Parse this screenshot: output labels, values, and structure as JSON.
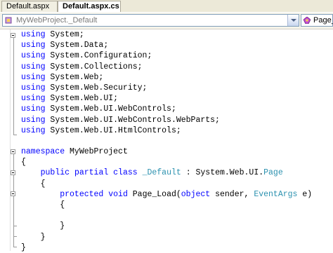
{
  "tabs": [
    {
      "label": "Default.aspx",
      "active": false
    },
    {
      "label": "Default.aspx.cs",
      "active": true
    }
  ],
  "navbar": {
    "class_combo": "MyWebProject._Default",
    "member_combo": "Page_"
  },
  "colors": {
    "keyword": "#0000ff",
    "type": "#2b91af",
    "text": "#000000"
  },
  "code": [
    [
      {
        "t": "using",
        "k": "kw"
      },
      {
        "t": " System;"
      }
    ],
    [
      {
        "t": "using",
        "k": "kw"
      },
      {
        "t": " System.Data;"
      }
    ],
    [
      {
        "t": "using",
        "k": "kw"
      },
      {
        "t": " System.Configuration;"
      }
    ],
    [
      {
        "t": "using",
        "k": "kw"
      },
      {
        "t": " System.Collections;"
      }
    ],
    [
      {
        "t": "using",
        "k": "kw"
      },
      {
        "t": " System.Web;"
      }
    ],
    [
      {
        "t": "using",
        "k": "kw"
      },
      {
        "t": " System.Web.Security;"
      }
    ],
    [
      {
        "t": "using",
        "k": "kw"
      },
      {
        "t": " System.Web.UI;"
      }
    ],
    [
      {
        "t": "using",
        "k": "kw"
      },
      {
        "t": " System.Web.UI.WebControls;"
      }
    ],
    [
      {
        "t": "using",
        "k": "kw"
      },
      {
        "t": " System.Web.UI.WebControls.WebParts;"
      }
    ],
    [
      {
        "t": "using",
        "k": "kw"
      },
      {
        "t": " System.Web.UI.HtmlControls;"
      }
    ],
    [],
    [
      {
        "t": "namespace",
        "k": "kw"
      },
      {
        "t": " MyWebProject"
      }
    ],
    [
      {
        "t": "{"
      }
    ],
    [
      {
        "t": "    "
      },
      {
        "t": "public",
        "k": "kw"
      },
      {
        "t": " "
      },
      {
        "t": "partial",
        "k": "kw"
      },
      {
        "t": " "
      },
      {
        "t": "class",
        "k": "kw"
      },
      {
        "t": " "
      },
      {
        "t": "_Default",
        "k": "ty"
      },
      {
        "t": " : System.Web.UI."
      },
      {
        "t": "Page",
        "k": "ty"
      }
    ],
    [
      {
        "t": "    {"
      }
    ],
    [
      {
        "t": "        "
      },
      {
        "t": "protected",
        "k": "kw"
      },
      {
        "t": " "
      },
      {
        "t": "void",
        "k": "kw"
      },
      {
        "t": " Page_Load("
      },
      {
        "t": "object",
        "k": "kw"
      },
      {
        "t": " sender, "
      },
      {
        "t": "EventArgs",
        "k": "ty"
      },
      {
        "t": " e)"
      }
    ],
    [
      {
        "t": "        {"
      }
    ],
    [],
    [
      {
        "t": "        }"
      }
    ],
    [
      {
        "t": "    }"
      }
    ],
    [
      {
        "t": "}"
      }
    ]
  ]
}
